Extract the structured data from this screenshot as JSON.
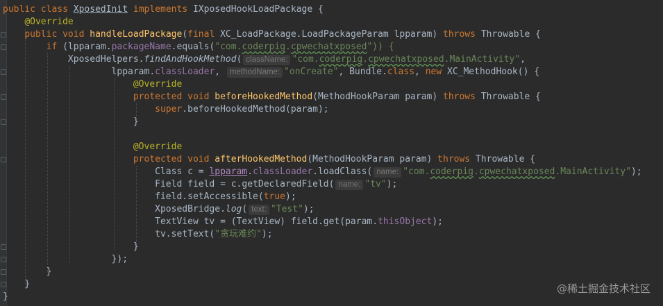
{
  "code": {
    "l1": [
      "public",
      "class",
      "XposedInit",
      "implements",
      "IXposedHookLoadPackage {"
    ],
    "l2": "@Override",
    "l3": [
      "public",
      "void",
      "handleLoadPackage",
      "(",
      "final",
      "XC_LoadPackage.LoadPackageParam",
      "lpparam",
      ") ",
      "throws",
      " Throwable {"
    ],
    "l4": [
      "if",
      " (lpparam.",
      "packageName",
      ".equals(",
      "\"com.",
      "coderpig",
      ".",
      "cpwechatxposed",
      "\")) {"
    ],
    "l5": [
      "XposedHelpers.",
      "findAndHookMethod",
      "(",
      "className:",
      "\"com.",
      "coderpig",
      ".",
      "cpwechatxposed",
      ".MainActivity\"",
      ","
    ],
    "l6": [
      "lpparam.",
      "classLoader",
      ",",
      "methodName:",
      "\"onCreate\"",
      ", Bundle.",
      "class",
      ", ",
      "new",
      " XC_MethodHook() {"
    ],
    "l7": "@Override",
    "l8": [
      "protected",
      "void",
      "beforeHookedMethod",
      "(MethodHookParam param) ",
      "throws",
      " Throwable {"
    ],
    "l9": [
      "super",
      ".beforeHookedMethod(param);"
    ],
    "l10": "}",
    "l12": "@Override",
    "l13": [
      "protected",
      "void",
      "afterHookedMethod",
      "(MethodHookParam param) ",
      "throws",
      " Throwable {"
    ],
    "l14": [
      "Class c = ",
      "lpparam",
      ".",
      "classLoader",
      ".loadClass(",
      "name:",
      "\"com.",
      "coderpig",
      ".",
      "cpwechatxposed",
      ".MainActivity\"",
      ");"
    ],
    "l15": [
      "Field field = c.getDeclaredField(",
      "name:",
      "\"tv\"",
      ");"
    ],
    "l16": [
      "field.setAccessible(",
      "true",
      ");"
    ],
    "l17": [
      "XposedBridge.",
      "log",
      "(",
      "text:",
      "\"Test\"",
      ");"
    ],
    "l18": [
      "TextView tv = (TextView) field.get(param.",
      "thisObject",
      ");"
    ],
    "l19": [
      "tv.setText(",
      "\"贪玩难约\"",
      ");"
    ],
    "l20": "}",
    "l21": "});",
    "l22": "}",
    "l23": "}",
    "l24": "}"
  },
  "watermark": "@稀土掘金技术社区",
  "colors": {
    "background": "#2b2b2b",
    "keyword": "#cc7832",
    "annotation": "#bbb529",
    "method_decl": "#ffc66d",
    "string": "#6a8759",
    "field": "#9876aa",
    "text": "#a9b7c6"
  }
}
